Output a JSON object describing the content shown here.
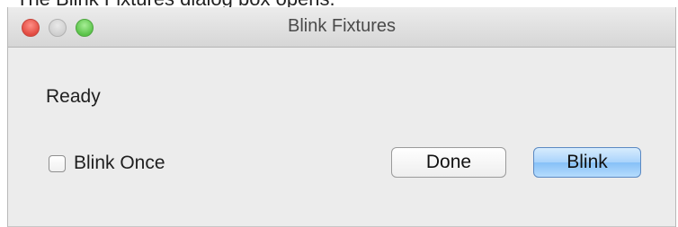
{
  "caption": "The Blink Fixtures dialog box opens.",
  "window": {
    "title": "Blink Fixtures",
    "controls": [
      "close",
      "minimize",
      "zoom"
    ]
  },
  "status_text": "Ready",
  "blink_once": {
    "label": "Blink Once",
    "checked": false
  },
  "buttons": {
    "done_label": "Done",
    "blink_label": "Blink"
  },
  "colors": {
    "default_button": "#a9d3fb",
    "close": "#e24b41",
    "zoom": "#5bc34a"
  }
}
